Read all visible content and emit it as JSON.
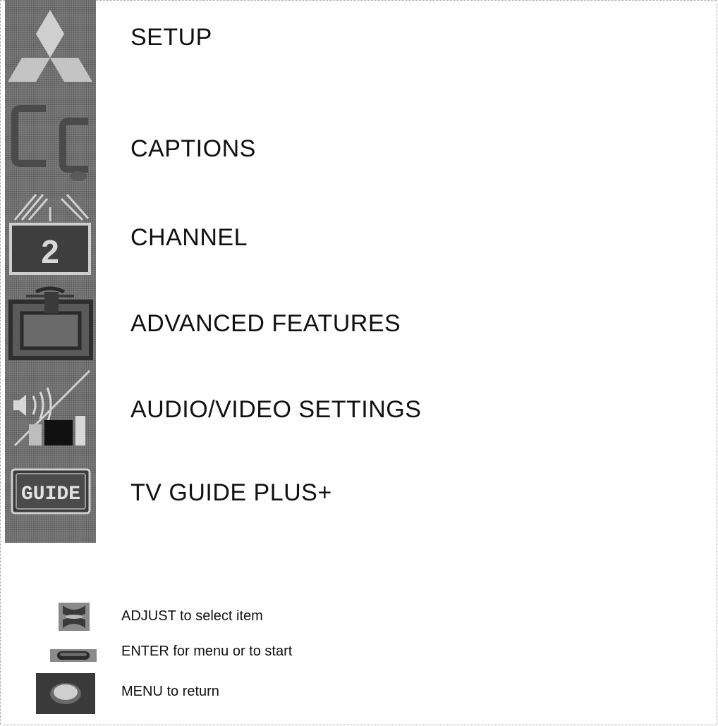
{
  "menu": {
    "items": [
      {
        "label": "SETUP",
        "icon": "mitsubishi-logo-icon"
      },
      {
        "label": "CAPTIONS",
        "icon": "cc-captions-icon"
      },
      {
        "label": "CHANNEL",
        "icon": "channel-antenna-icon",
        "icon_text": "2"
      },
      {
        "label": "ADVANCED FEATURES",
        "icon": "advanced-features-icon"
      },
      {
        "label": "AUDIO/VIDEO SETTINGS",
        "icon": "audio-video-icon"
      },
      {
        "label": "TV GUIDE PLUS+",
        "icon": "guide-icon",
        "icon_text": "GUIDE"
      }
    ]
  },
  "hints": [
    {
      "label": "ADJUST to select item",
      "icon": "adjust-rocker-icon"
    },
    {
      "label": "ENTER for menu or to start",
      "icon": "enter-button-icon"
    },
    {
      "label": "MENU to return",
      "icon": "menu-button-icon"
    }
  ],
  "colors": {
    "strip": "#7a7a7a",
    "icon_dark": "#3a3a3a",
    "icon_light": "#d0d0d0",
    "text": "#111111"
  }
}
